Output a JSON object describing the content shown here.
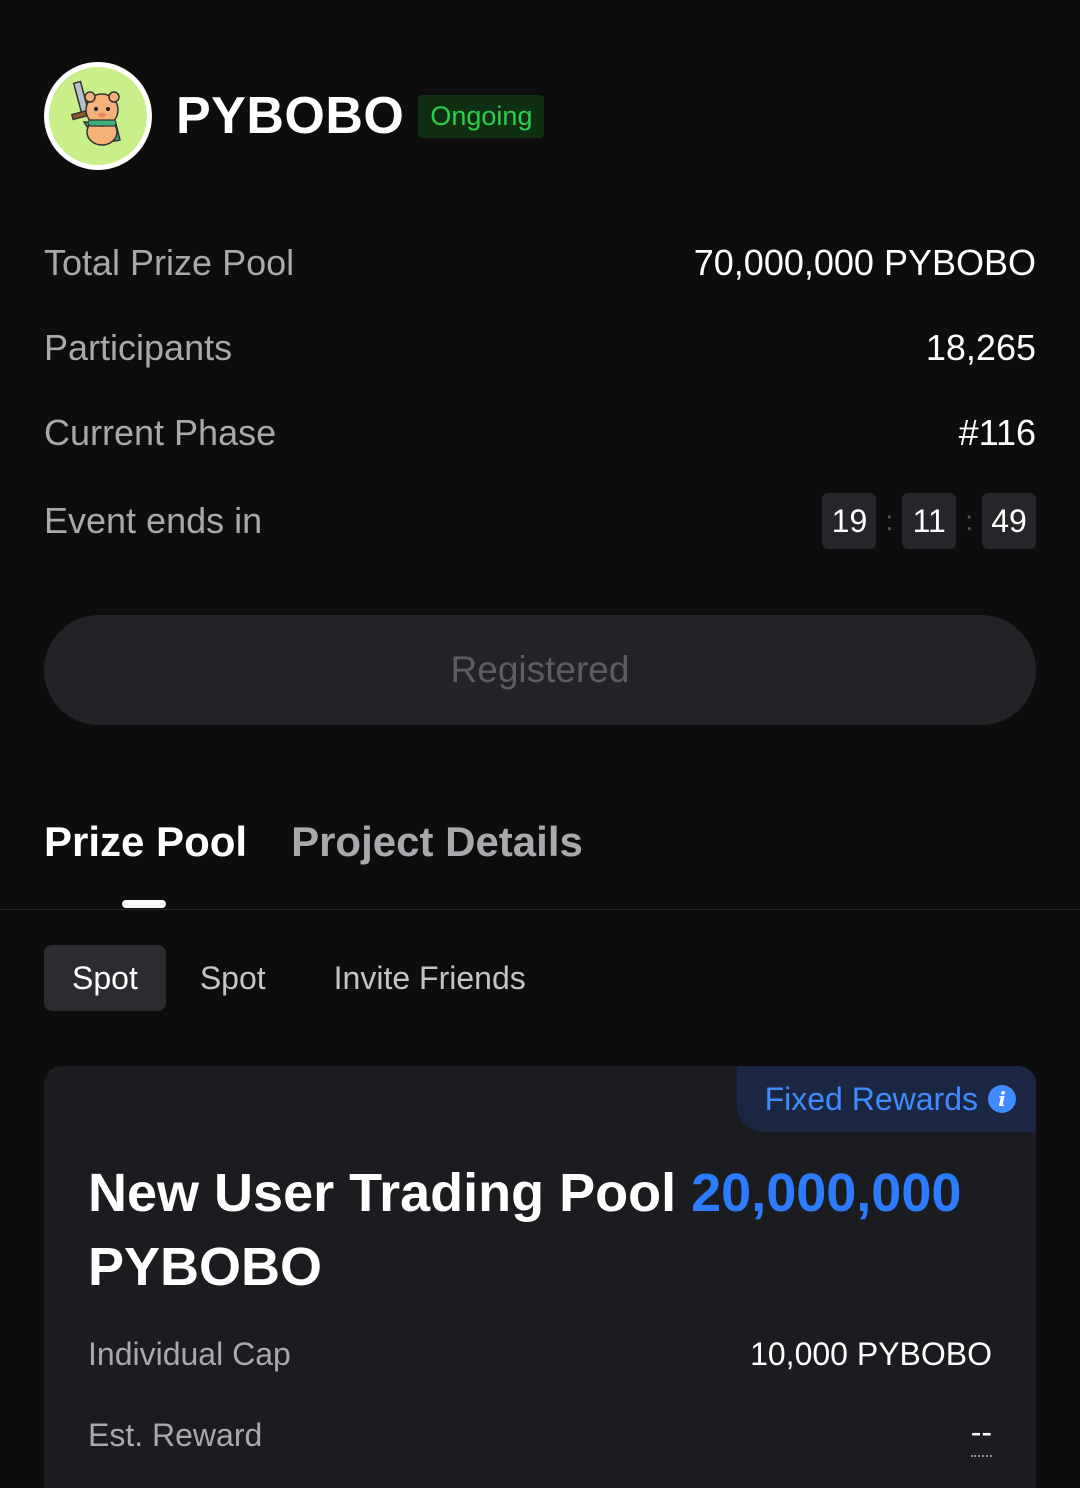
{
  "header": {
    "token_name": "PYBOBO",
    "status": "Ongoing",
    "avatar_icon": "bear-warrior-mascot-icon"
  },
  "stats": {
    "total_prize_pool_label": "Total Prize Pool",
    "total_prize_pool_value": "70,000,000 PYBOBO",
    "participants_label": "Participants",
    "participants_value": "18,265",
    "current_phase_label": "Current Phase",
    "current_phase_value": "#116",
    "event_ends_label": "Event ends in",
    "countdown": {
      "hours": "19",
      "minutes": "11",
      "seconds": "49",
      "separator": ":"
    }
  },
  "register_button": {
    "label": "Registered"
  },
  "tabs": [
    {
      "label": "Prize Pool",
      "active": true
    },
    {
      "label": "Project Details",
      "active": false
    }
  ],
  "subtabs": [
    {
      "label": "Spot",
      "active": true
    },
    {
      "label": "Spot",
      "active": false
    },
    {
      "label": "Invite Friends",
      "active": false
    }
  ],
  "card": {
    "tag": "Fixed Rewards",
    "tag_icon": "info-icon",
    "title_prefix": "New User Trading Pool",
    "title_amount": "20,000,000",
    "title_suffix": "PYBOBO",
    "individual_cap_label": "Individual Cap",
    "individual_cap_value": "10,000 PYBOBO",
    "est_reward_label": "Est. Reward",
    "est_reward_value": "--"
  },
  "colors": {
    "background": "#0d0d0e",
    "status_green": "#2bcf4e",
    "accent_blue": "#2d7cff"
  }
}
